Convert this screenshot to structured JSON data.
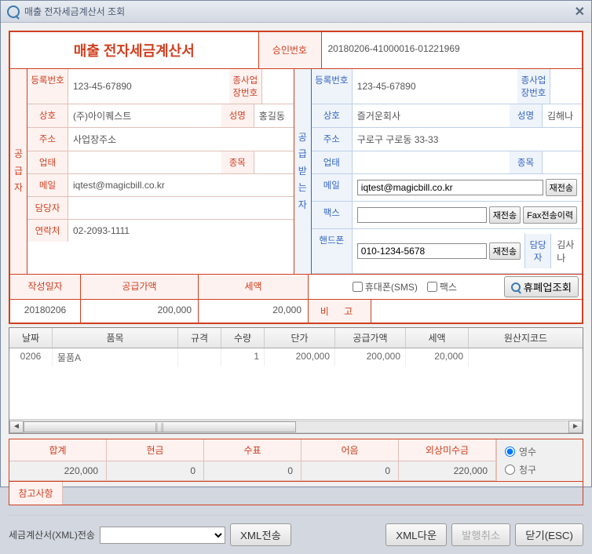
{
  "window": {
    "title": "매출 전자세금계산서 조회"
  },
  "header": {
    "doc_title": "매출 전자세금계산서",
    "approval_label": "승인번호",
    "approval_no": "20180206-41000016-01221969"
  },
  "supplier": {
    "vert": "공급자",
    "rows": {
      "reg_label": "등록번호",
      "reg_no": "123-45-67890",
      "sub_biz_label": "종사업장번호",
      "sub_biz": "",
      "name_label": "상호",
      "name": "(주)아이퀘스트",
      "ceo_label": "성명",
      "ceo": "홍길동",
      "addr_label": "주소",
      "addr": "사업장주소",
      "biztype_label": "업태",
      "biztype": "",
      "item_label": "종목",
      "item": "",
      "email_label": "메일",
      "email": "iqtest@magicbill.co.kr",
      "mgr_label": "담당자",
      "mgr": "",
      "tel_label": "연락처",
      "tel": "02-2093-1111"
    }
  },
  "buyer": {
    "vert": "공급받는자",
    "rows": {
      "reg_label": "등록번호",
      "reg_no": "123-45-67890",
      "sub_biz_label": "종사업장번호",
      "sub_biz": "",
      "name_label": "상호",
      "name": "즐거운회사",
      "ceo_label": "성명",
      "ceo": "김해나",
      "addr_label": "주소",
      "addr": "구로구 구로동 33-33",
      "biztype_label": "업태",
      "biztype": "",
      "item_label": "종목",
      "item": "",
      "email_label": "메일",
      "email": "iqtest@magicbill.co.kr",
      "resend": "재전송",
      "fax_label": "팩스",
      "fax": "",
      "fax_resend": "재전송",
      "fax_hist": "Fax전송이력",
      "phone_label": "핸드폰",
      "phone": "010-1234-5678",
      "phone_resend": "재전송",
      "mgr_label": "담당자",
      "mgr": "김사나"
    }
  },
  "mid": {
    "date_label": "작성일자",
    "supply_label": "공급가액",
    "tax_label": "세액",
    "sms": "휴대폰(SMS)",
    "fax": "팩스",
    "biz_check": "휴폐업조회",
    "date": "20180206",
    "supply": "200,000",
    "tax": "20,000",
    "remark_label": "비 고"
  },
  "grid": {
    "headers": [
      "날짜",
      "품목",
      "규격",
      "수량",
      "단가",
      "공급가액",
      "세액",
      "원산지코드"
    ],
    "rows": [
      {
        "date": "0206",
        "item": "물품A",
        "spec": "",
        "qty": "1",
        "price": "200,000",
        "supply": "200,000",
        "tax": "20,000",
        "origin": ""
      }
    ]
  },
  "totals": {
    "labels": [
      "합계",
      "현금",
      "수표",
      "어음",
      "외상미수금"
    ],
    "values": [
      "220,000",
      "0",
      "0",
      "0",
      "220,000"
    ],
    "receipt": "영수",
    "claim": "청구"
  },
  "ref": {
    "label": "참고사항",
    "value": ""
  },
  "footer": {
    "xml_label": "세금계산서(XML)전송",
    "xml_send": "XML전송",
    "xml_down": "XML다운",
    "cancel": "발행취소",
    "close": "닫기(ESC)"
  }
}
